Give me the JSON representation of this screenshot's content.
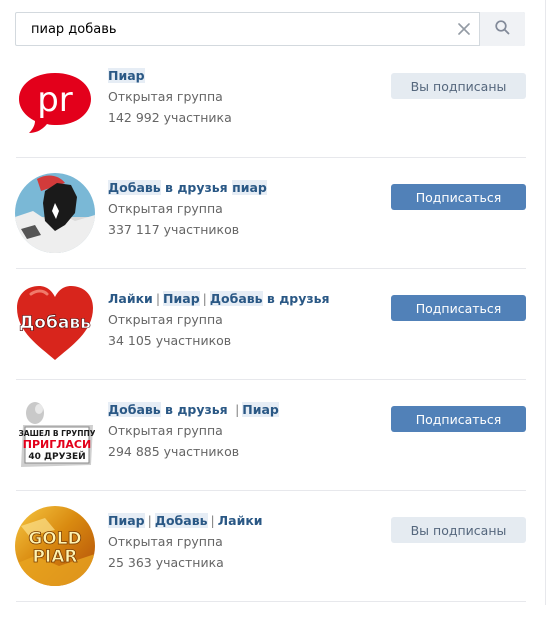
{
  "search": {
    "value": "пиар добавь",
    "clear_icon": "close-icon",
    "search_icon": "search-icon"
  },
  "groups": [
    {
      "name_parts": [
        {
          "text": "Пиар",
          "hl": true
        }
      ],
      "type": "Открытая группа",
      "members": "142 992 участника",
      "button": "Вы подписаны",
      "subscribed": true,
      "avatar": {
        "text": "pr",
        "bg": "#e3001b"
      }
    },
    {
      "name_parts": [
        {
          "text": "Добавь",
          "hl": true
        },
        {
          "text": " в друзья ",
          "hl": false
        },
        {
          "text": "пиар",
          "hl": true
        }
      ],
      "type": "Открытая группа",
      "members": "337 117 участников",
      "button": "Подписаться",
      "subscribed": false
    },
    {
      "name_parts": [
        {
          "text": "Лайки",
          "hl": false
        },
        {
          "sep": "|"
        },
        {
          "text": "Пиар",
          "hl": true
        },
        {
          "sep": "|"
        },
        {
          "text": "Добавь",
          "hl": true
        },
        {
          "text": " в друзья",
          "hl": false
        }
      ],
      "type": "Открытая группа",
      "members": "34 105 участников",
      "button": "Подписаться",
      "subscribed": false,
      "avatar": {
        "text": "Добавь"
      }
    },
    {
      "name_parts": [
        {
          "text": "Добавь",
          "hl": true
        },
        {
          "text": " в друзья ",
          "hl": false
        },
        {
          "sep": "|"
        },
        {
          "text": "Пиар",
          "hl": true
        }
      ],
      "type": "Открытая группа",
      "members": "294 885 участников",
      "button": "Подписаться",
      "subscribed": false,
      "avatar": {
        "line1": "ЗАШЕЛ В ГРУППУ",
        "line2": "ПРИГЛАСИ",
        "line3": "40 ДРУЗЕЙ"
      }
    },
    {
      "name_parts": [
        {
          "text": "Пиар",
          "hl": true
        },
        {
          "sep": "|"
        },
        {
          "text": "Добавь",
          "hl": true
        },
        {
          "sep": "|"
        },
        {
          "text": "Лайки",
          "hl": false
        }
      ],
      "type": "Открытая группа",
      "members": "25 363 участника",
      "button": "Вы подписаны",
      "subscribed": true,
      "avatar": {
        "line1": "GOLD",
        "line2": "PIAR"
      }
    }
  ],
  "colors": {
    "link": "#2a5885",
    "button_primary": "#5181b8",
    "button_secondary": "#e5ebf1",
    "highlight": "#e6edf5"
  }
}
